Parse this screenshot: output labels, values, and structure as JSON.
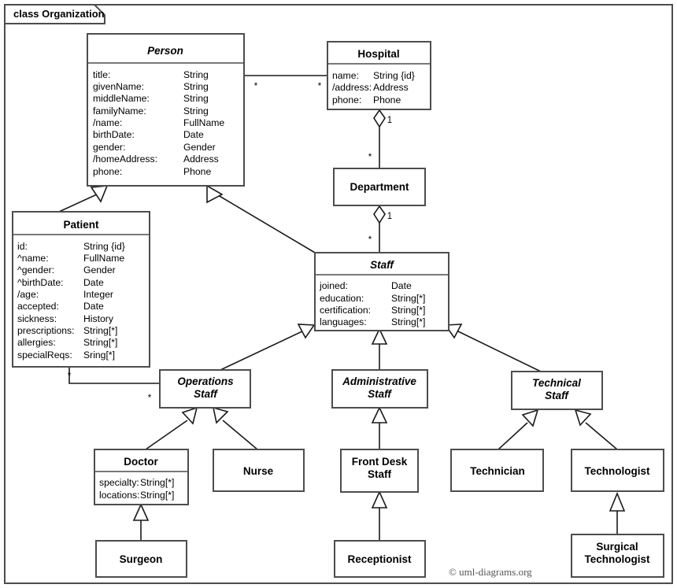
{
  "frame": {
    "label": "class Organization"
  },
  "credit": "© uml-diagrams.org",
  "classes": {
    "person": {
      "name": "Person",
      "abstract": true,
      "attributes": [
        {
          "name": "title:",
          "type": "String"
        },
        {
          "name": "givenName:",
          "type": "String"
        },
        {
          "name": "middleName:",
          "type": "String"
        },
        {
          "name": "familyName:",
          "type": "String"
        },
        {
          "name": "/name:",
          "type": "FullName"
        },
        {
          "name": "birthDate:",
          "type": "Date"
        },
        {
          "name": "gender:",
          "type": "Gender"
        },
        {
          "name": "/homeAddress:",
          "type": "Address"
        },
        {
          "name": "phone:",
          "type": "Phone"
        }
      ]
    },
    "hospital": {
      "name": "Hospital",
      "abstract": false,
      "attributes": [
        {
          "name": "name:",
          "type": "String {id}"
        },
        {
          "name": "/address:",
          "type": "Address"
        },
        {
          "name": "phone:",
          "type": "Phone"
        }
      ]
    },
    "department": {
      "name": "Department",
      "abstract": false,
      "attributes": []
    },
    "patient": {
      "name": "Patient",
      "abstract": false,
      "attributes": [
        {
          "name": "id:",
          "type": "String {id}"
        },
        {
          "name": "^name:",
          "type": "FullName"
        },
        {
          "name": "^gender:",
          "type": "Gender"
        },
        {
          "name": "^birthDate:",
          "type": "Date"
        },
        {
          "name": "/age:",
          "type": "Integer"
        },
        {
          "name": "accepted:",
          "type": "Date"
        },
        {
          "name": "sickness:",
          "type": "History"
        },
        {
          "name": "prescriptions:",
          "type": "String[*]"
        },
        {
          "name": "allergies:",
          "type": "String[*]"
        },
        {
          "name": "specialReqs:",
          "type": "Sring[*]"
        }
      ]
    },
    "staff": {
      "name": "Staff",
      "abstract": true,
      "attributes": [
        {
          "name": "joined:",
          "type": "Date"
        },
        {
          "name": "education:",
          "type": "String[*]"
        },
        {
          "name": "certification:",
          "type": "String[*]"
        },
        {
          "name": "languages:",
          "type": "String[*]"
        }
      ]
    },
    "operations_staff": {
      "name_line1": "Operations",
      "name_line2": "Staff",
      "abstract": true
    },
    "administrative_staff": {
      "name_line1": "Administrative",
      "name_line2": "Staff",
      "abstract": true
    },
    "technical_staff": {
      "name_line1": "Technical",
      "name_line2": "Staff",
      "abstract": true
    },
    "doctor": {
      "name": "Doctor",
      "abstract": false,
      "attributes": [
        {
          "name": "specialty:",
          "type": "String[*]"
        },
        {
          "name": "locations:",
          "type": "String[*]"
        }
      ]
    },
    "nurse": {
      "name": "Nurse",
      "abstract": false
    },
    "front_desk_staff": {
      "name_line1": "Front Desk",
      "name_line2": "Staff",
      "abstract": false
    },
    "technician": {
      "name": "Technician",
      "abstract": false
    },
    "technologist": {
      "name": "Technologist",
      "abstract": false
    },
    "surgeon": {
      "name": "Surgeon",
      "abstract": false
    },
    "receptionist": {
      "name": "Receptionist",
      "abstract": false
    },
    "surgical_technologist": {
      "name_line1": "Surgical",
      "name_line2": "Technologist",
      "abstract": false
    }
  },
  "multiplicities": {
    "person_hospital_person_end": "*",
    "person_hospital_hospital_end": "*",
    "hospital_department_hospital_end": "1",
    "hospital_department_department_end": "*",
    "department_staff_department_end": "1",
    "department_staff_staff_end": "*",
    "patient_operations_patient_end": "*",
    "patient_operations_staff_end": "*"
  },
  "colors": {
    "box_stroke": "#4d4d4d",
    "line": "#1a1a1a",
    "background": "#ffffff",
    "credit_text": "#555555"
  }
}
